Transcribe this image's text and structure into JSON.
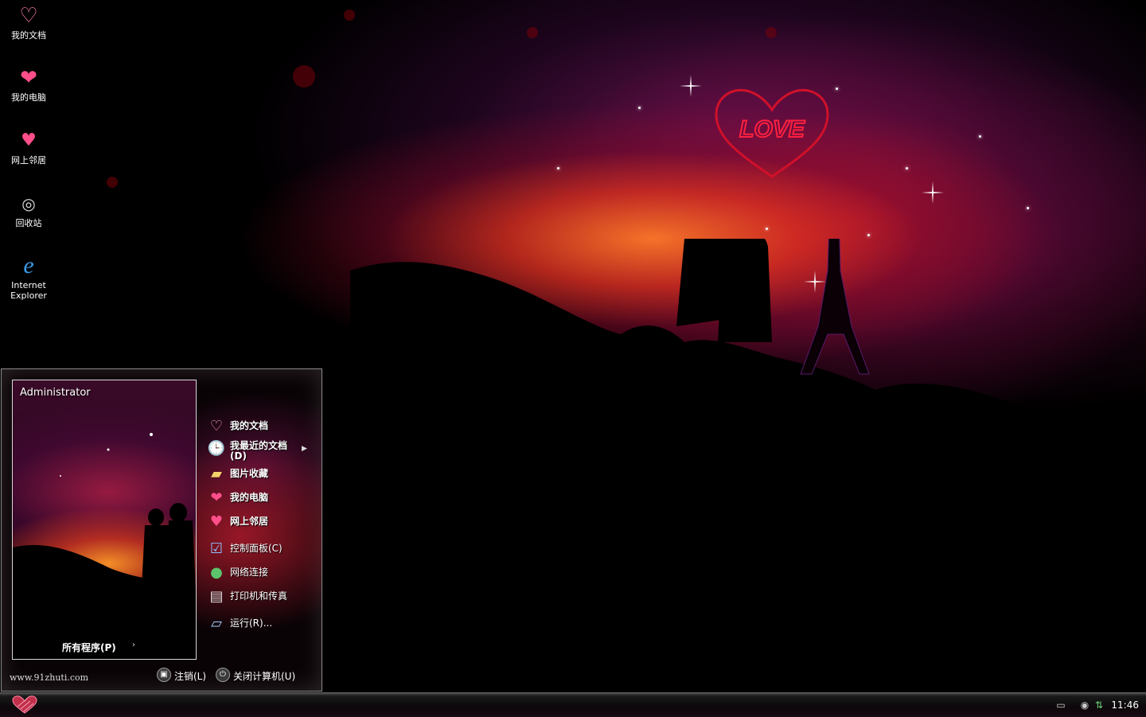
{
  "desktop": {
    "icons": [
      {
        "label": "我的文档",
        "icon": "heart-doc-icon"
      },
      {
        "label": "我的电脑",
        "icon": "heart-computer-icon"
      },
      {
        "label": "网上邻居",
        "icon": "heart-network-icon"
      },
      {
        "label": "回收站",
        "icon": "recycle-bin-icon"
      },
      {
        "label": "Internet Explorer",
        "icon": "internet-explorer-icon"
      }
    ],
    "wallpaper_text": "LOVE"
  },
  "start_menu": {
    "user_name": "Administrator",
    "all_programs": "所有程序(P)",
    "items": [
      {
        "label": "我的文档",
        "icon": "my-documents-icon",
        "bold": true
      },
      {
        "label": "我最近的文档(D)",
        "icon": "recent-documents-icon",
        "bold": true
      },
      {
        "label": "图片收藏",
        "icon": "my-pictures-icon",
        "bold": true
      },
      {
        "label": "我的电脑",
        "icon": "my-computer-icon",
        "bold": true
      },
      {
        "label": "网上邻居",
        "icon": "network-places-icon",
        "bold": true
      },
      {
        "label": "控制面板(C)",
        "icon": "control-panel-icon",
        "bold": false
      },
      {
        "label": "网络连接",
        "icon": "network-connections-icon",
        "bold": false
      },
      {
        "label": "打印机和传真",
        "icon": "printers-faxes-icon",
        "bold": false
      },
      {
        "label": "运行(R)...",
        "icon": "run-icon",
        "bold": false
      }
    ],
    "watermark": "www.91zhuti.com",
    "logoff_label": "注销(L)",
    "shutdown_label": "关闭计算机(U)"
  },
  "taskbar": {
    "clock": "11:46"
  },
  "colors": {
    "heart": "#ff4f8a",
    "taskbar_bg": "#0c070a",
    "panel_border": "#d8d8d8"
  }
}
